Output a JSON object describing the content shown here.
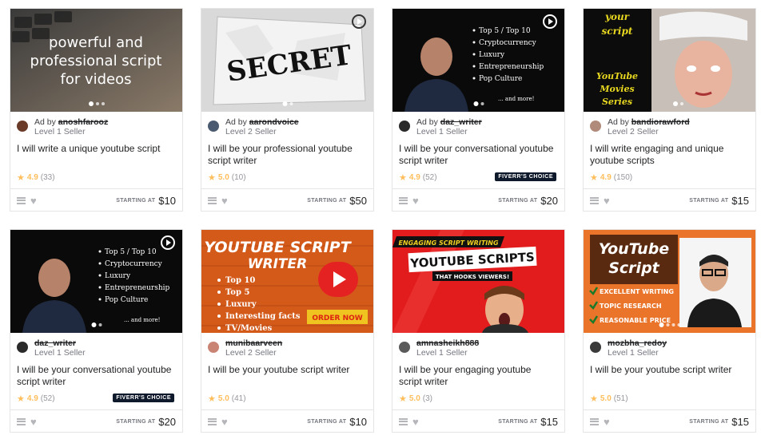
{
  "cards": [
    {
      "ad_by": "Ad by",
      "seller": "anoshfarooz",
      "level": "Level 1 Seller",
      "title": "I will write a unique youtube script",
      "rating": "4.9",
      "reviews": "(33)",
      "starting": "STARTING AT",
      "price": "$10",
      "thumb_text": [
        "powerful and",
        "professional script",
        "for videos"
      ]
    },
    {
      "ad_by": "Ad by",
      "seller": "aarondvoice",
      "level": "Level 2 Seller",
      "title": "I will be your professional youtube script writer",
      "rating": "5.0",
      "reviews": "(10)",
      "starting": "STARTING AT",
      "price": "$50",
      "thumb_text": [
        "SECRET"
      ]
    },
    {
      "ad_by": "Ad by",
      "seller": "daz_writer",
      "level": "Level 1 Seller",
      "title": "I will be your conversational youtube script writer",
      "rating": "4.9",
      "reviews": "(52)",
      "starting": "STARTING AT",
      "price": "$20",
      "badge": "FIVERR'S CHOICE",
      "thumb_text": [
        "Top 5 / Top 10",
        "Cryptocurrency",
        "Luxury",
        "Entrepreneurship",
        "Pop Culture",
        "... and more!"
      ]
    },
    {
      "ad_by": "Ad by",
      "seller": "bandiorawford",
      "level": "Level 2 Seller",
      "title": "I will write engaging and unique youtube scripts",
      "rating": "4.9",
      "reviews": "(150)",
      "starting": "STARTING AT",
      "price": "$15",
      "thumb_text": [
        "your",
        "script",
        "YouTube",
        "Movies",
        "Series"
      ]
    },
    {
      "ad_by": "",
      "seller": "daz_writer",
      "level": "Level 1 Seller",
      "title": "I will be your conversational youtube script writer",
      "rating": "4.9",
      "reviews": "(52)",
      "starting": "STARTING AT",
      "price": "$20",
      "badge": "FIVERR'S CHOICE",
      "thumb_text": [
        "Top 5 / Top 10",
        "Cryptocurrency",
        "Luxury",
        "Entrepreneurship",
        "Pop Culture",
        "... and more!"
      ]
    },
    {
      "ad_by": "",
      "seller": "munibaarveen",
      "level": "Level 2 Seller",
      "title": "I will be your youtube script writer",
      "rating": "5.0",
      "reviews": "(41)",
      "starting": "STARTING AT",
      "price": "$10",
      "thumb_text": [
        "YOUTUBE SCRIPT",
        "WRITER",
        "Top 10",
        "Top 5",
        "Luxury",
        "Interesting facts",
        "TV/Movies",
        "ORDER NOW"
      ]
    },
    {
      "ad_by": "",
      "seller": "amnasheikh888",
      "level": "Level 1 Seller",
      "title": "I will be your engaging youtube script writer",
      "rating": "5.0",
      "reviews": "(3)",
      "starting": "STARTING AT",
      "price": "$15",
      "thumb_text": [
        "ENGAGING SCRIPT WRITING",
        "YOUTUBE SCRIPTS",
        "THAT HOOKS VIEWERS!"
      ]
    },
    {
      "ad_by": "",
      "seller": "mozbha_redoy",
      "level": "Level 1 Seller",
      "title": "I will be your youtube script writer",
      "rating": "5.0",
      "reviews": "(51)",
      "starting": "STARTING AT",
      "price": "$15",
      "thumb_text": [
        "YouTube",
        "Script",
        "EXCELLENT WRITING",
        "TOPIC RESEARCH",
        "REASONABLE PRICE"
      ]
    }
  ],
  "colors": {
    "star": "#ffbe5b",
    "badge_bg": "#0e1a2b",
    "border": "#e4e5e7"
  }
}
